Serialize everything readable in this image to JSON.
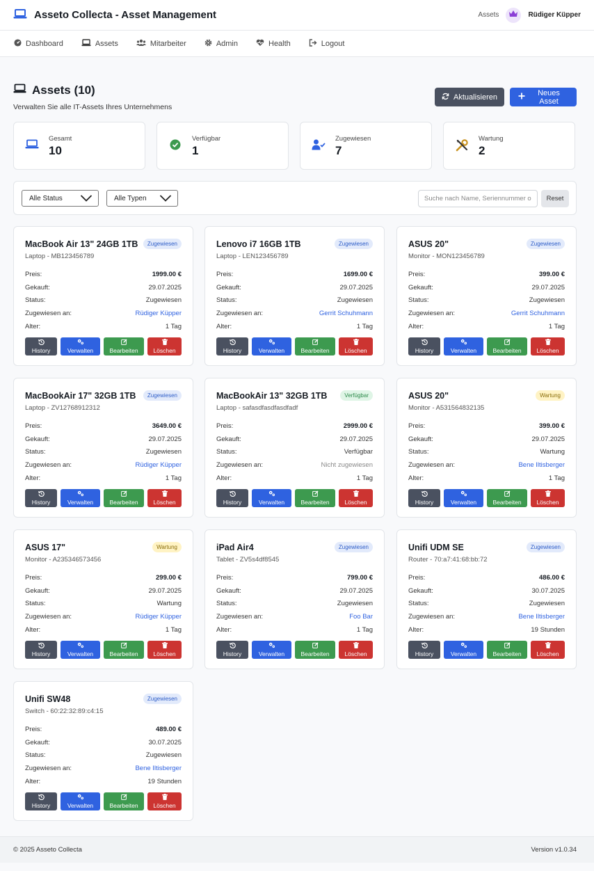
{
  "app": {
    "title": "Asseto Collecta - Asset Management"
  },
  "topbar": {
    "section": "Assets",
    "user": "Rüdiger Küpper"
  },
  "nav": [
    {
      "label": "Dashboard",
      "icon": "dashboard-icon"
    },
    {
      "label": "Assets",
      "icon": "laptop-icon"
    },
    {
      "label": "Mitarbeiter",
      "icon": "users-icon"
    },
    {
      "label": "Admin",
      "icon": "gear-icon"
    },
    {
      "label": "Health",
      "icon": "heartbeat-icon"
    },
    {
      "label": "Logout",
      "icon": "logout-icon"
    }
  ],
  "page": {
    "title": "Assets (10)",
    "subtitle": "Verwalten Sie alle IT-Assets Ihres Unternehmens",
    "refresh_label": "Aktualisieren",
    "new_label": "Neues Asset"
  },
  "stats": [
    {
      "label": "Gesamt",
      "value": "10",
      "icon": "laptop-icon",
      "color": "#2f62e0"
    },
    {
      "label": "Verfügbar",
      "value": "1",
      "icon": "check-circle-icon",
      "color": "#3d9a4f"
    },
    {
      "label": "Zugewiesen",
      "value": "7",
      "icon": "user-check-icon",
      "color": "#2f62e0"
    },
    {
      "label": "Wartung",
      "value": "2",
      "icon": "tools-icon",
      "color": "#c8921e"
    }
  ],
  "filters": {
    "status": "Alle Status",
    "type": "Alle Typen",
    "search_placeholder": "Suche nach Name, Seriennummer o",
    "reset_label": "Reset"
  },
  "labels": {
    "price": "Preis:",
    "bought": "Gekauft:",
    "status": "Status:",
    "assigned_to": "Zugewiesen an:",
    "age": "Alter:",
    "history": "History",
    "manage": "Verwalten",
    "edit": "Bearbeiten",
    "delete": "Löschen"
  },
  "assets": [
    {
      "name": "MacBook Air 13\" 24GB 1TB",
      "sub": "Laptop - MB123456789",
      "badge": "Zugewiesen",
      "badge_kind": "assigned",
      "price": "1999.00 €",
      "bought": "29.07.2025",
      "status": "Zugewiesen",
      "assigned": "Rüdiger Küpper",
      "assigned_kind": "link",
      "age": "1 Tag"
    },
    {
      "name": "Lenovo i7 16GB 1TB",
      "sub": "Laptop - LEN123456789",
      "badge": "Zugewiesen",
      "badge_kind": "assigned",
      "price": "1699.00 €",
      "bought": "29.07.2025",
      "status": "Zugewiesen",
      "assigned": "Gerrit Schuhmann",
      "assigned_kind": "link",
      "age": "1 Tag"
    },
    {
      "name": "ASUS 20\"",
      "sub": "Monitor - MON123456789",
      "badge": "Zugewiesen",
      "badge_kind": "assigned",
      "price": "399.00 €",
      "bought": "29.07.2025",
      "status": "Zugewiesen",
      "assigned": "Gerrit Schuhmann",
      "assigned_kind": "link",
      "age": "1 Tag"
    },
    {
      "name": "MacBookAir 17\" 32GB 1TB",
      "sub": "Laptop - ZV12768912312",
      "badge": "Zugewiesen",
      "badge_kind": "assigned",
      "price": "3649.00 €",
      "bought": "29.07.2025",
      "status": "Zugewiesen",
      "assigned": "Rüdiger Küpper",
      "assigned_kind": "link",
      "age": "1 Tag"
    },
    {
      "name": "MacBookAir 13\" 32GB 1TB",
      "sub": "Laptop - safasdfasdfasdfadf",
      "badge": "Verfügbar",
      "badge_kind": "available",
      "price": "2999.00 €",
      "bought": "29.07.2025",
      "status": "Verfügbar",
      "assigned": "Nicht zugewiesen",
      "assigned_kind": "muted",
      "age": "1 Tag"
    },
    {
      "name": "ASUS 20\"",
      "sub": "Monitor - A531564832135",
      "badge": "Wartung",
      "badge_kind": "maintenance",
      "price": "399.00 €",
      "bought": "29.07.2025",
      "status": "Wartung",
      "assigned": "Bene Iltisberger",
      "assigned_kind": "link",
      "age": "1 Tag"
    },
    {
      "name": "ASUS 17\"",
      "sub": "Monitor - A235346573456",
      "badge": "Wartung",
      "badge_kind": "maintenance",
      "price": "299.00 €",
      "bought": "29.07.2025",
      "status": "Wartung",
      "assigned": "Rüdiger Küpper",
      "assigned_kind": "link",
      "age": "1 Tag"
    },
    {
      "name": "iPad Air4",
      "sub": "Tablet - ZV5s4df8545",
      "badge": "Zugewiesen",
      "badge_kind": "assigned",
      "price": "799.00 €",
      "bought": "29.07.2025",
      "status": "Zugewiesen",
      "assigned": "Foo Bar",
      "assigned_kind": "link",
      "age": "1 Tag"
    },
    {
      "name": "Unifi UDM SE",
      "sub": "Router - 70:a7:41:68:bb:72",
      "badge": "Zugewiesen",
      "badge_kind": "assigned",
      "price": "486.00 €",
      "bought": "30.07.2025",
      "status": "Zugewiesen",
      "assigned": "Bene Iltisberger",
      "assigned_kind": "link",
      "age": "19 Stunden"
    },
    {
      "name": "Unifi SW48",
      "sub": "Switch - 60:22:32:89:c4:15",
      "badge": "Zugewiesen",
      "badge_kind": "assigned",
      "price": "489.00 €",
      "bought": "30.07.2025",
      "status": "Zugewiesen",
      "assigned": "Bene Iltisberger",
      "assigned_kind": "link",
      "age": "19 Stunden"
    }
  ],
  "footer": {
    "copyright": "© 2025 Asseto Collecta",
    "version": "Version v1.0.34"
  }
}
